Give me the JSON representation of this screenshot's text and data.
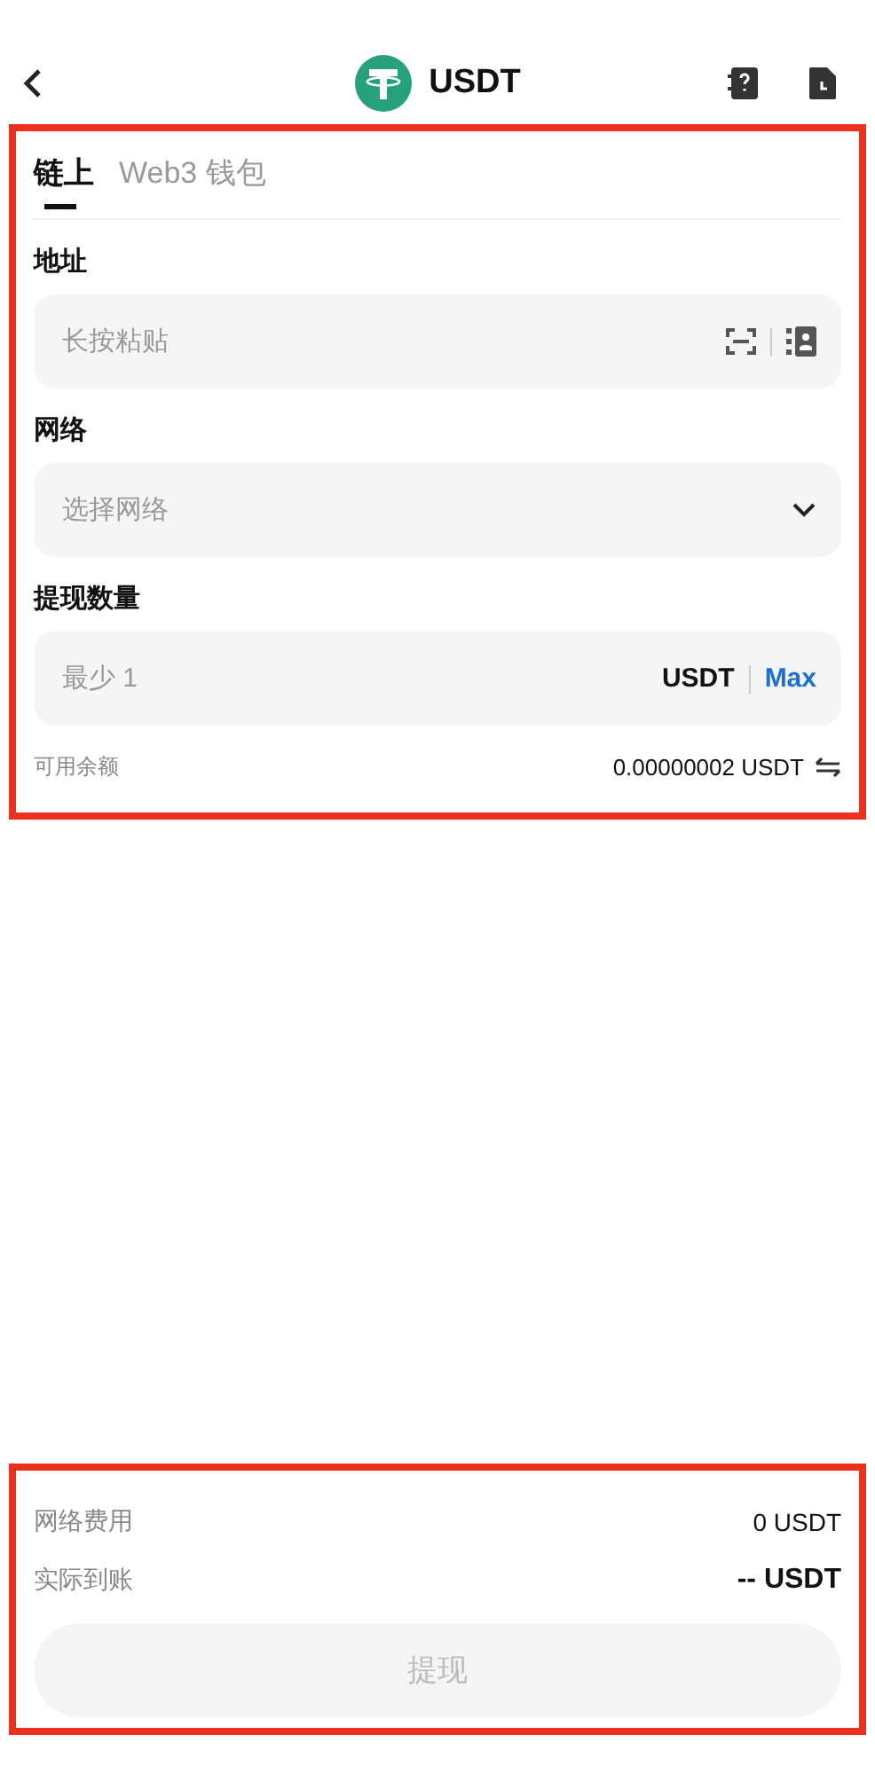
{
  "header": {
    "title": "USDT"
  },
  "form_panel": {
    "highlighted": true,
    "tabs": [
      {
        "label": "链上",
        "selected": true
      },
      {
        "label": "Web3 钱包",
        "selected": false
      }
    ],
    "address": {
      "label": "地址",
      "placeholder": "长按粘贴"
    },
    "network": {
      "label": "网络",
      "placeholder": "选择网络"
    },
    "amount": {
      "label": "提现数量",
      "placeholder": "最少 1",
      "unit": "USDT",
      "max": "Max"
    },
    "balance": {
      "label": "可用余额",
      "value": "0.00000002 USDT"
    }
  },
  "summary_panel": {
    "highlighted": true,
    "rows": [
      {
        "label": "网络费用",
        "value": "0 USDT",
        "bold": false
      },
      {
        "label": "实际到账",
        "value": "-- USDT",
        "bold": true
      }
    ],
    "submit": {
      "label": "提现",
      "disabled": true
    }
  }
}
